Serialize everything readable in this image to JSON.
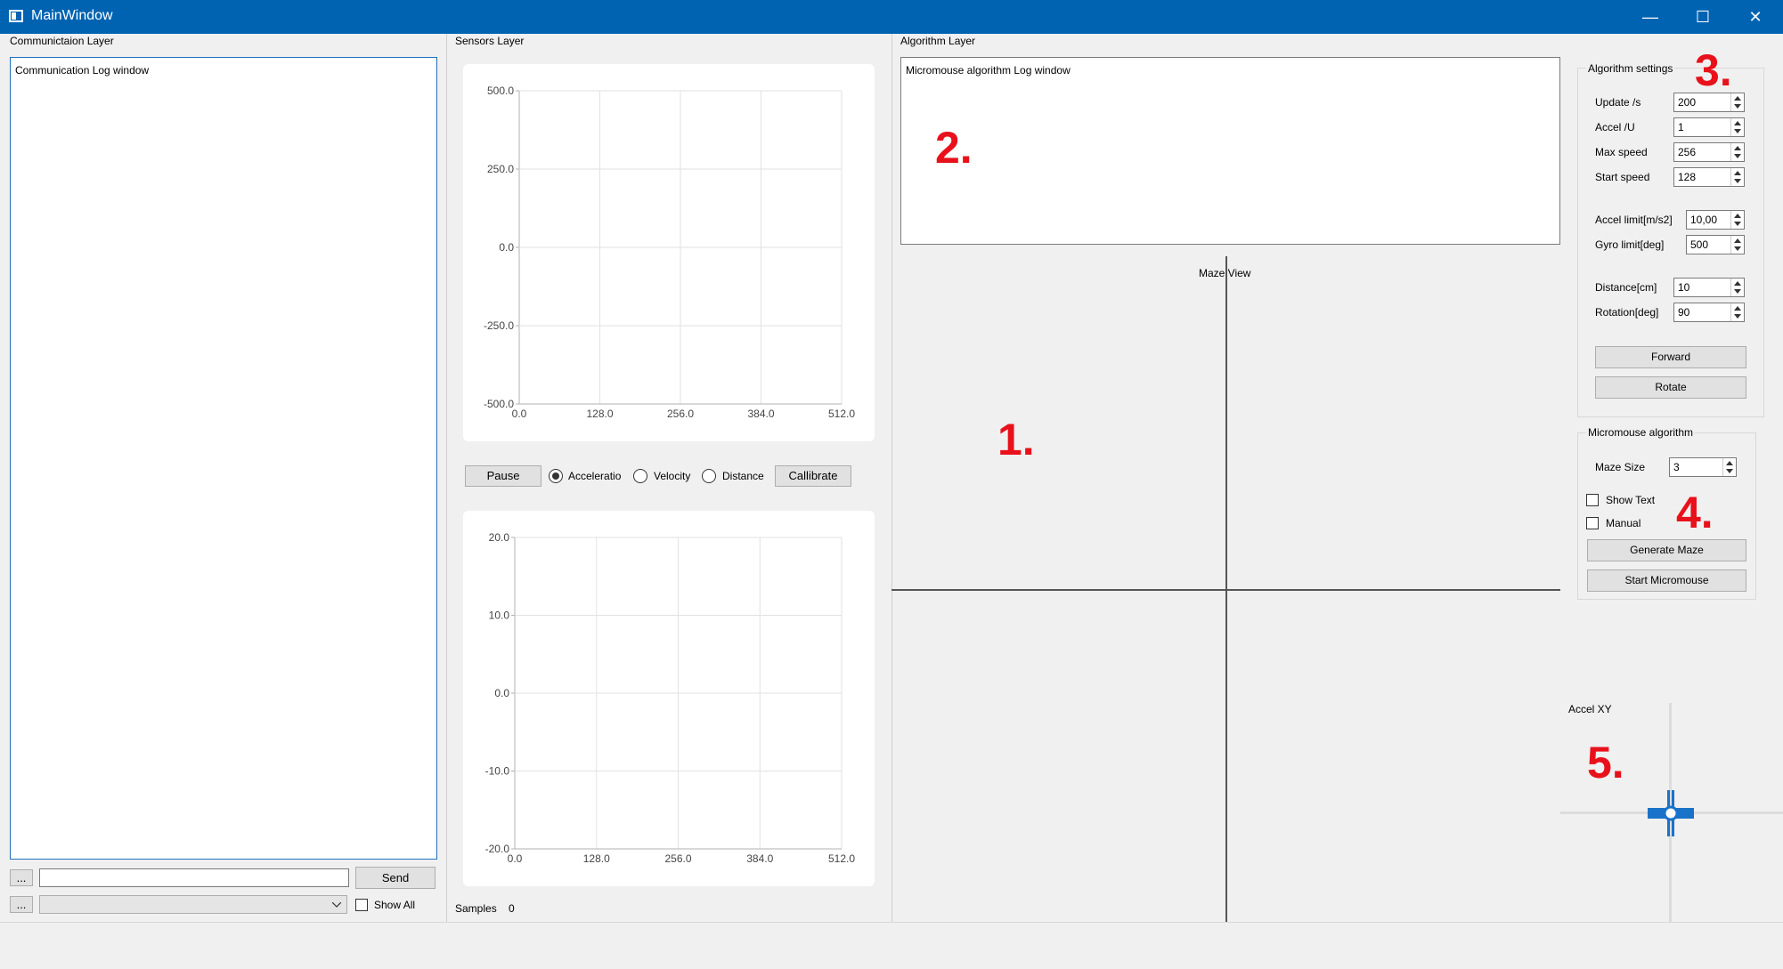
{
  "window": {
    "title": "MainWindow",
    "minimize": "—",
    "maximize": "☐",
    "close": "✕"
  },
  "comm": {
    "title": "Communictaion Layer",
    "log_text": "Communication Log window",
    "more1": "...",
    "more2": "...",
    "send_input_value": "",
    "send_label": "Send",
    "combo_value": "",
    "show_all_label": "Show All"
  },
  "sensors": {
    "title": "Sensors Layer",
    "pause_label": "Pause",
    "radio_acceleration": "Acceleratio",
    "radio_velocity": "Velocity",
    "radio_distance": "Distance",
    "calibrate_label": "Callibrate",
    "samples_label": "Samples",
    "samples_value": "0"
  },
  "chart_data": [
    {
      "type": "line",
      "title": "",
      "xlabel": "",
      "ylabel": "",
      "x_ticks": [
        "0.0",
        "128.0",
        "256.0",
        "384.0",
        "512.0"
      ],
      "y_ticks": [
        "500.0",
        "250.0",
        "0.0",
        "-250.0",
        "-500.0"
      ],
      "xlim": [
        0,
        512
      ],
      "ylim": [
        -500,
        500
      ],
      "grid": true,
      "series": []
    },
    {
      "type": "line",
      "title": "",
      "xlabel": "",
      "ylabel": "",
      "x_ticks": [
        "0.0",
        "128.0",
        "256.0",
        "384.0",
        "512.0"
      ],
      "y_ticks": [
        "20.0",
        "10.0",
        "0.0",
        "-10.0",
        "-20.0"
      ],
      "xlim": [
        0,
        512
      ],
      "ylim": [
        -20,
        20
      ],
      "grid": true,
      "series": []
    }
  ],
  "algorithm": {
    "title": "Algorithm Layer",
    "log_text": "Micromouse algorithm Log window",
    "maze_view_label": "Maze View",
    "accel_xy_label": "Accel XY"
  },
  "settings": {
    "title": "Algorithm settings",
    "update_label": "Update /s",
    "update_value": "200",
    "accel_label": "Accel /U",
    "accel_value": "1",
    "max_speed_label": "Max speed",
    "max_speed_value": "256",
    "start_speed_label": "Start speed",
    "start_speed_value": "128",
    "accel_limit_label": "Accel limit[m/s2]",
    "accel_limit_value": "10,00",
    "gyro_limit_label": "Gyro limit[deg]",
    "gyro_limit_value": "500",
    "distance_label": "Distance[cm]",
    "distance_value": "10",
    "rotation_label": "Rotation[deg]",
    "rotation_value": "90",
    "forward_label": "Forward",
    "rotate_label": "Rotate"
  },
  "micromouse": {
    "title": "Micromouse algorithm",
    "maze_size_label": "Maze Size",
    "maze_size_value": "3",
    "show_text_label": "Show Text",
    "manual_label": "Manual",
    "generate_label": "Generate Maze",
    "start_label": "Start Micromouse"
  },
  "annotations": {
    "a1": "1.",
    "a2": "2.",
    "a3": "3.",
    "a4": "4.",
    "a5": "5."
  },
  "colors": {
    "titlebar": "#0063b1",
    "annotation": "#e8111b",
    "accel_marker": "#1a73c9"
  }
}
